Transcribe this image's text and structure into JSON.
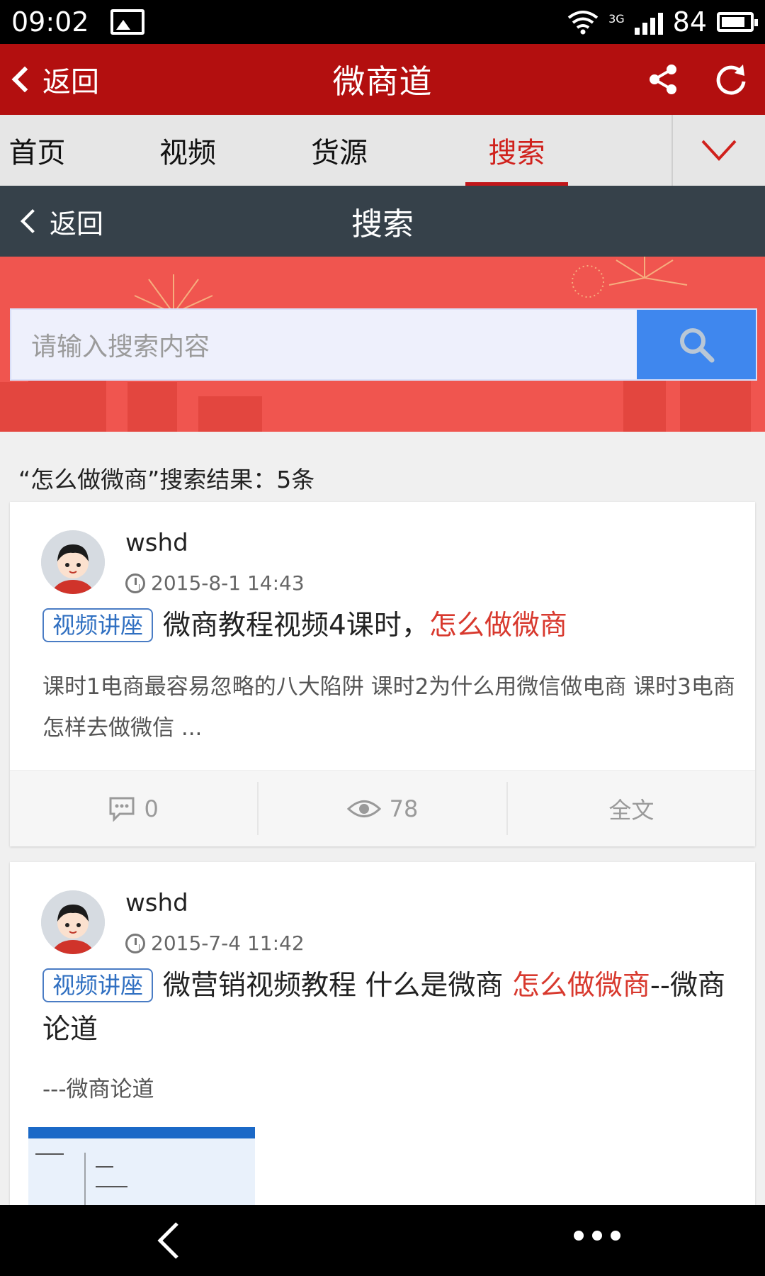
{
  "status_bar": {
    "time": "09:02",
    "network": "3G",
    "battery": "84"
  },
  "app_bar": {
    "back_label": "返回",
    "title": "微商道",
    "share_icon": "share-icon",
    "refresh_icon": "refresh-icon"
  },
  "tabs": [
    {
      "label": "首页"
    },
    {
      "label": "视频"
    },
    {
      "label": "货源"
    },
    {
      "label": "搜索",
      "active": true
    }
  ],
  "sub_bar": {
    "back_label": "返回",
    "title": "搜索"
  },
  "search": {
    "placeholder": "请输入搜索内容"
  },
  "result_summary": "“怎么做微商”搜索结果：5条",
  "results": [
    {
      "user": "wshd",
      "time": "2015-8-1 14:43",
      "tag": "视频讲座",
      "title_before": "微商教程视频4课时，",
      "title_highlight": "怎么做微商",
      "title_after": "",
      "excerpt": "课时1电商最容易忽略的八大陷阱 课时2为什么用微信做电商 课时3电商怎样去做微信 ...",
      "comments": "0",
      "views": "78",
      "full_text": "全文"
    },
    {
      "user": "wshd",
      "time": "2015-7-4 11:42",
      "tag": "视频讲座",
      "title_before": "微营销视频教程 什么是微商 ",
      "title_highlight": "怎么做微商",
      "title_after": "--微商论道",
      "excerpt": "---微商论道"
    }
  ],
  "colors": {
    "app_bar": "#b30f0f",
    "sub_bar": "#36414a",
    "banner": "#f0554f",
    "accent": "#d0211c",
    "search_button": "#3f87ee",
    "tag": "#2f6fc1"
  }
}
